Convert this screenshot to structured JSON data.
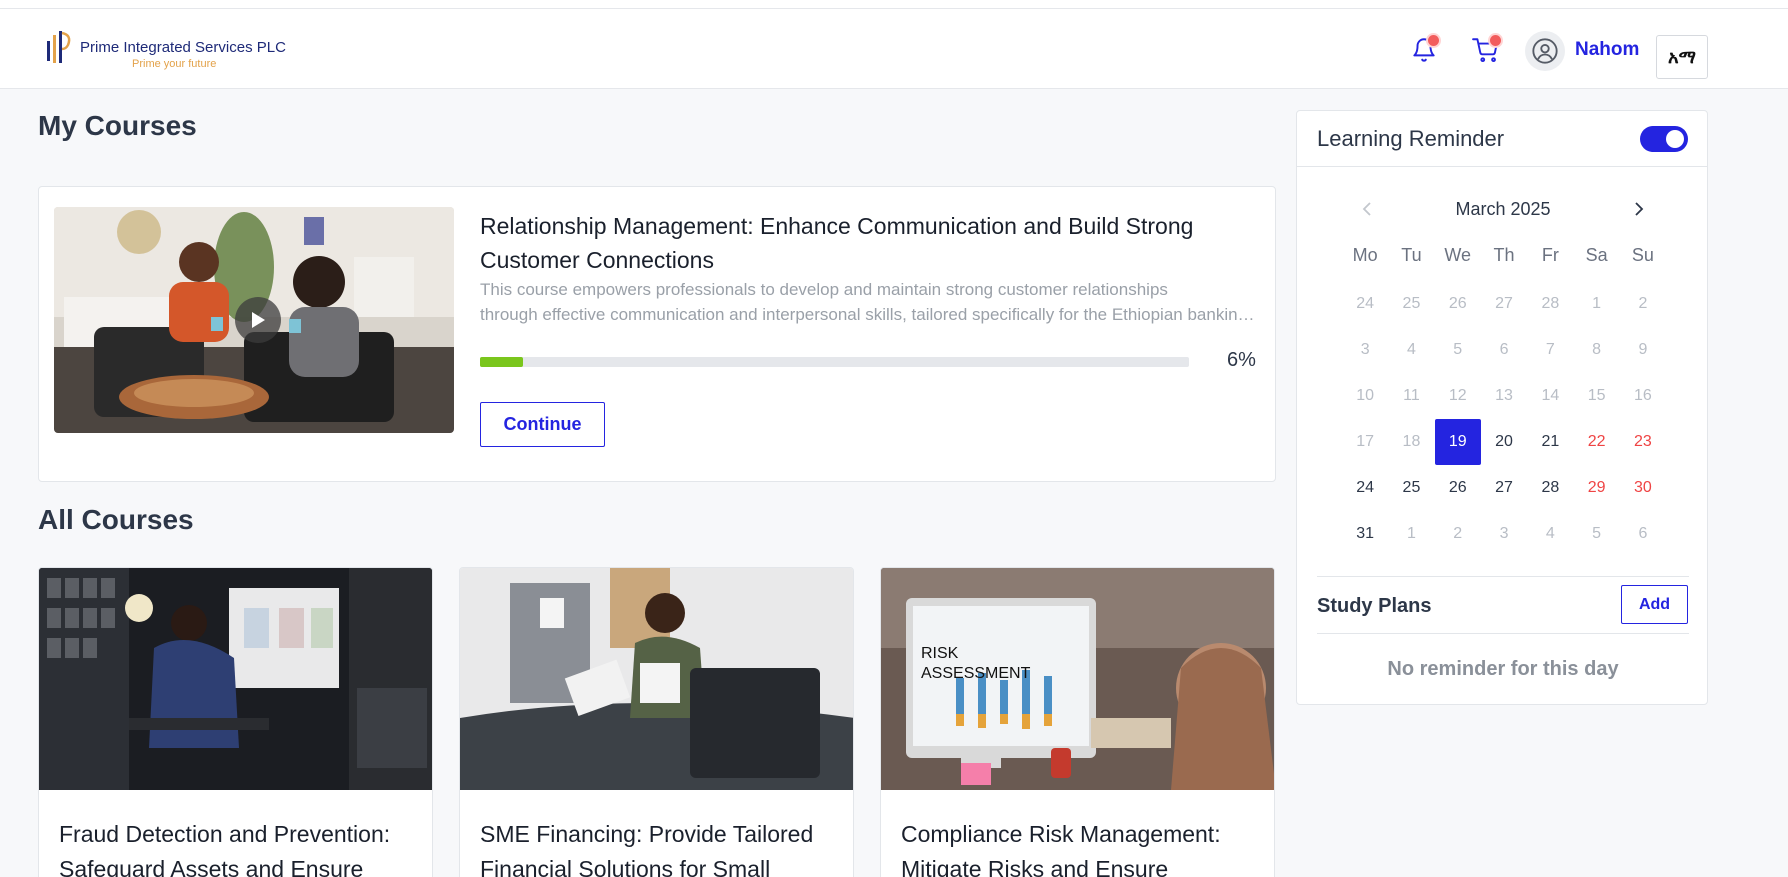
{
  "header": {
    "company_name": "Prime Integrated Services PLC",
    "tagline": "Prime your future",
    "username": "Nahom",
    "language_label": "አማ"
  },
  "my_courses": {
    "heading": "My Courses",
    "course": {
      "title": "Relationship Management: Enhance Communication and Build Strong Customer Connections",
      "description_line1": "This course empowers professionals to develop and maintain strong customer relationships",
      "description_line2": "through effective communication and interpersonal skills, tailored specifically for the Ethiopian banking sector.",
      "progress_label": "6%",
      "progress_fraction": 0.06,
      "continue_label": "Continue"
    }
  },
  "all_courses": {
    "heading": "All Courses",
    "cards": [
      {
        "title": "Fraud Detection and Prevention: Safeguard Assets and Ensure"
      },
      {
        "title": "SME Financing: Provide Tailored Financial Solutions for Small"
      },
      {
        "title": "Compliance Risk Management: Mitigate Risks and Ensure"
      }
    ],
    "risk_text_1": "RISK",
    "risk_text_2": "ASSESSMENT"
  },
  "sidebar": {
    "title": "Learning Reminder",
    "reminder_enabled": true,
    "calendar": {
      "month_label": "March 2025",
      "weekdays": [
        "Mo",
        "Tu",
        "We",
        "Th",
        "Fr",
        "Sa",
        "Su"
      ],
      "weeks": [
        [
          "24",
          "25",
          "26",
          "27",
          "28",
          "1",
          "2"
        ],
        [
          "3",
          "4",
          "5",
          "6",
          "7",
          "8",
          "9"
        ],
        [
          "10",
          "11",
          "12",
          "13",
          "14",
          "15",
          "16"
        ],
        [
          "17",
          "18",
          "19",
          "20",
          "21",
          "22",
          "23"
        ],
        [
          "24",
          "25",
          "26",
          "27",
          "28",
          "29",
          "30"
        ],
        [
          "31",
          "1",
          "2",
          "3",
          "4",
          "5",
          "6"
        ]
      ],
      "selected_day": "19"
    },
    "study_plans_title": "Study Plans",
    "add_label": "Add",
    "empty_message": "No reminder for this day"
  },
  "colors": {
    "accent": "#2424e0",
    "progress": "#7ac61c",
    "weekend": "#ef4444"
  }
}
